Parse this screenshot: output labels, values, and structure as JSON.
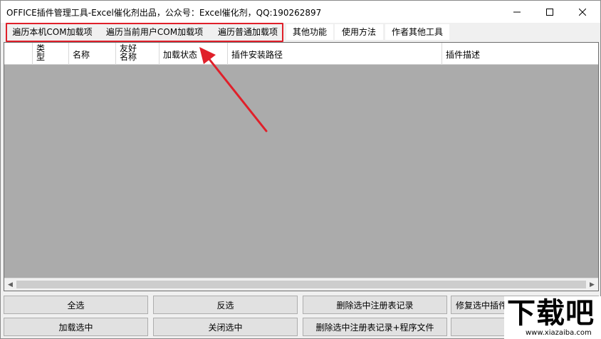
{
  "window": {
    "title": "OFFICE插件管理工具-Excel催化剂出品，公众号：Excel催化剂，QQ:190262897",
    "controls": {
      "minimize_icon": "minimize-icon",
      "maximize_icon": "maximize-icon",
      "close_icon": "close-icon"
    }
  },
  "tabs": [
    {
      "label": "遍历本机COM加载项"
    },
    {
      "label": "遍历当前用户COM加载项"
    },
    {
      "label": "遍历普通加载项"
    },
    {
      "label": "其他功能"
    },
    {
      "label": "使用方法"
    },
    {
      "label": "作者其他工具"
    }
  ],
  "grid": {
    "columns": [
      {
        "label": ""
      },
      {
        "label": "类型"
      },
      {
        "label": "名称"
      },
      {
        "label": "友好名称"
      },
      {
        "label": "加载状态"
      },
      {
        "label": "插件安装路径"
      },
      {
        "label": "插件描述"
      }
    ],
    "rows": []
  },
  "buttons": {
    "row1": [
      {
        "label": "全选"
      },
      {
        "label": "反选"
      },
      {
        "label": "删除选中注册表记录"
      },
      {
        "label": "修复选中插件"
      }
    ],
    "row2": [
      {
        "label": "加载选中"
      },
      {
        "label": "关闭选中"
      },
      {
        "label": "删除选中注册表记录+程序文件"
      },
      {
        "label": ""
      }
    ]
  },
  "annotation": {
    "color": "#e0202a"
  },
  "watermark": {
    "text": "下载吧",
    "url": "www.xiazaiba.com"
  }
}
